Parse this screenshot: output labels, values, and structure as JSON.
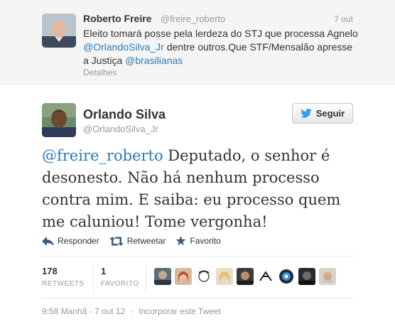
{
  "parent_tweet": {
    "author_name": "Roberto Freire",
    "author_handle": "@freire_roberto",
    "time": "7 out",
    "text_part1": "Eleito tomará posse pela lerdeza do STJ que processa Agnelo ",
    "mention1": "@OrlandoSilva_Jr",
    "text_part2": " dentre outros.Que STF/Mensalão apresse a Justiça ",
    "mention2": "@brasilianas",
    "details_label": "Detalhes"
  },
  "tweet": {
    "author_name": "Orlando Silva",
    "author_handle": "@OrlandoSilva_Jr",
    "follow_label": "Seguir",
    "mention": "@freire_roberto",
    "text": " Deputado, o senhor é desonesto. Não há nenhum processo contra mim. E saiba: eu processo quem me caluniou! Tome vergonha!"
  },
  "actions": {
    "reply": "Responder",
    "retweet": "Retweetar",
    "favorite": "Favorito"
  },
  "stats": {
    "retweets_count": "178",
    "retweets_label": "RETWEETS",
    "favorites_count": "1",
    "favorites_label": "FAVORITO"
  },
  "footer": {
    "timestamp": "9:58 Manhã - 7 out 12",
    "separator": "·",
    "embed_label": "Incorporar este Tweet"
  },
  "colors": {
    "link": "#2b7bb9",
    "secondary_text": "#999999",
    "twitter_bird": "#2ea1ec"
  }
}
